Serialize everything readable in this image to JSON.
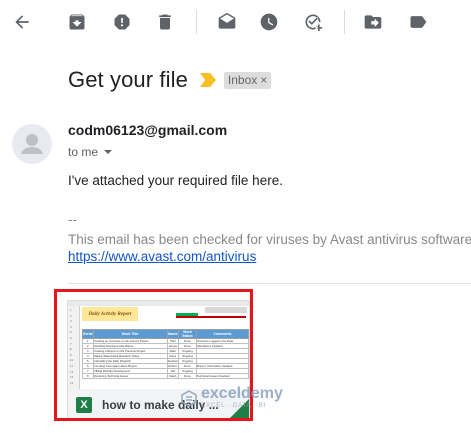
{
  "toolbar": {
    "icons": [
      "back-arrow-icon",
      "archive-icon",
      "report-spam-icon",
      "delete-icon",
      "mark-unread-icon",
      "snooze-icon",
      "add-to-tasks-icon",
      "move-to-icon",
      "labels-icon"
    ]
  },
  "email": {
    "subject": "Get your file",
    "label": "Inbox",
    "label_close": "×",
    "sender": "codm06123@gmail.com",
    "to": "to me",
    "body": "I've attached your required file here.",
    "signature_dash": "--",
    "signature_text": "This email has been checked for viruses by Avast antivirus software.",
    "signature_link": "https://www.avast.com/antivirus"
  },
  "attachment": {
    "name": "how to make daily ...",
    "type_letter": "X",
    "preview": {
      "title": "Daily Activity Report",
      "headers": [
        "Serial",
        "Work Title",
        "Name",
        "Work Status",
        "Comments"
      ],
      "rows": [
        [
          "1",
          "Creating an Overview on the Current Project",
          "Paul",
          "Done",
          "Overview Logged in the Data"
        ],
        [
          "2",
          "Checking Employee Attendance",
          "James",
          "Done",
          "Attendance Updated"
        ],
        [
          "3",
          "Creating a Report on the Previous Project",
          "Mark",
          "Ongoing",
          ""
        ],
        [
          "4",
          "Making Watermarks Research Notes",
          "Steve",
          "Ongoing",
          ""
        ],
        [
          "5",
          "Calculating the Daily Dispatch",
          "Stephen",
          "Ongoing",
          ""
        ],
        [
          "6",
          "Inventing Information about Buyers",
          "Robert",
          "Done",
          "Buyers' Information Updated"
        ],
        [
          "7",
          "Official Website Development",
          "Jeff",
          "Ongoing",
          ""
        ],
        [
          "8",
          "Monitoring Technical Issues",
          "Caleb",
          "Done",
          "Technical Issues Checked"
        ]
      ]
    }
  },
  "watermark": {
    "name": "exceldemy",
    "tagline": "EXCEL · DATA · BI"
  },
  "colors": {
    "highlight": "#e8141c",
    "link": "#1155cc",
    "importance": "#f6bf26",
    "excel_green": "#1e7e45"
  }
}
